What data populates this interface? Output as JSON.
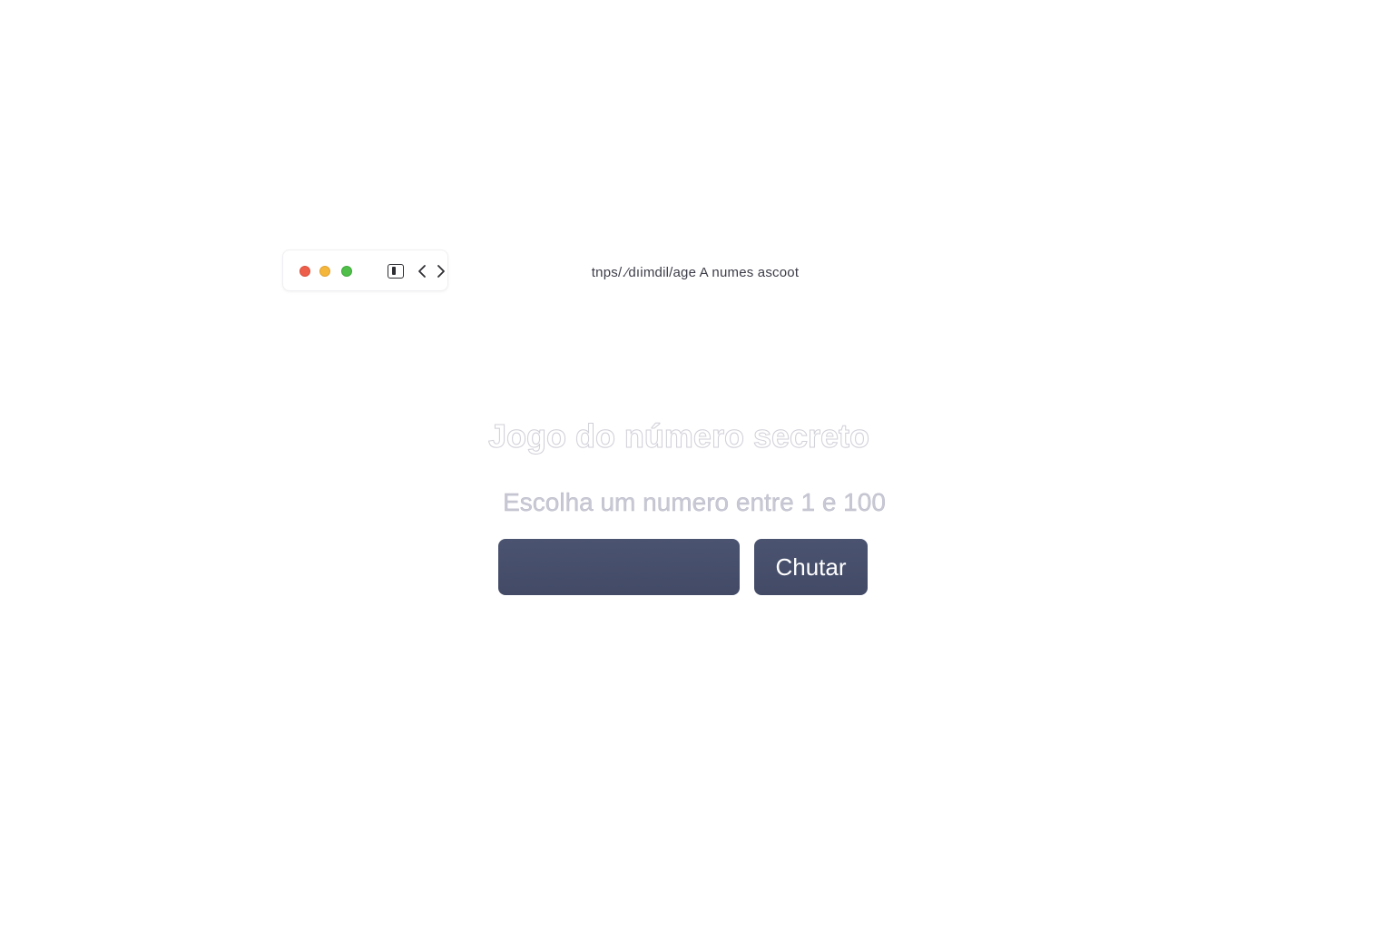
{
  "browser": {
    "window_controls": {
      "close_color": "#ed5f4a",
      "minimize_color": "#f5b63c",
      "maximize_color": "#4fbf4a"
    },
    "icons": [
      "sidebar-icon",
      "back-arrow-icon",
      "forward-arrow-icon"
    ],
    "url": "tnps/.⁄dıimdil/age A numes ascoot"
  },
  "game": {
    "title": "Jogo do número secreto",
    "subtitle": "Escolha um numero entre 1 e 100",
    "input_value": "",
    "button_label": "Chutar",
    "accent_color": "#474f6b"
  }
}
